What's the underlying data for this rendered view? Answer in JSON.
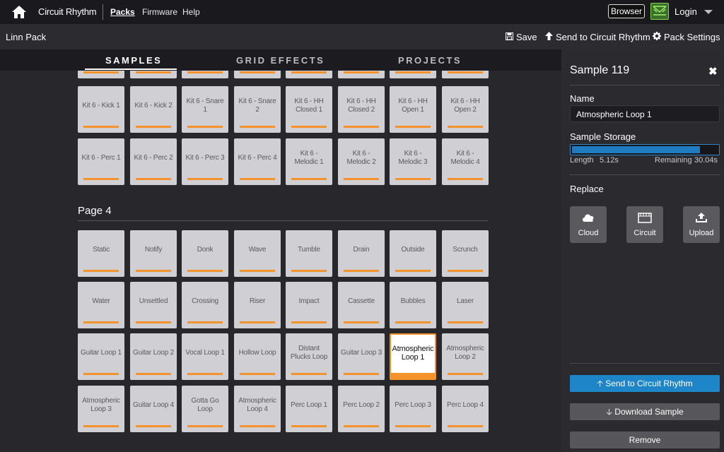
{
  "nav": {
    "brand": "Circuit Rhythm",
    "links": [
      "Packs",
      "Firmware",
      "Help"
    ],
    "browser_label": "Browser",
    "login_label": "Login"
  },
  "pack": {
    "name": "Linn Pack",
    "save_label": "Save",
    "send_label": "Send to Circuit Rhythm",
    "settings_label": "Pack Settings"
  },
  "tabs": [
    "SAMPLES",
    "GRID EFFECTS",
    "PROJECTS"
  ],
  "grid": {
    "page3_rows": [
      [
        "Kit 6 - Kick 1",
        "Kit 6 - Kick 2",
        "Kit 6 - Snare 1",
        "Kit 6 - Snare 2",
        "Kit 6 - HH Closed 1",
        "Kit 6 - HH Closed 2",
        "Kit 6 - HH Open 1",
        "Kit 6 - HH Open 2"
      ],
      [
        "Kit 6 - Perc 1",
        "Kit 6 - Perc 2",
        "Kit 6 - Perc 3",
        "Kit 6 - Perc 4",
        "Kit 6 - Melodic 1",
        "Kit 6 - Melodic 2",
        "Kit 6 - Melodic 3",
        "Kit 6 - Melodic 4"
      ]
    ],
    "page4_heading": "Page 4",
    "page4_rows": [
      [
        "Static",
        "Notify",
        "Donk",
        "Wave",
        "Tumble",
        "Drain",
        "Outside",
        "Scrunch"
      ],
      [
        "Water",
        "Unsettled",
        "Crossing",
        "Riser",
        "Impact",
        "Cassette",
        "Bubbles",
        "Laser"
      ],
      [
        "Guitar Loop 1",
        "Guitar Loop 2",
        "Vocal Loop 1",
        "Hollow Loop",
        "Distant Plucks Loop",
        "Guitar Loop 3",
        "Atmospheric Loop 1",
        "Atmospheric Loop 2"
      ],
      [
        "Atmospheric Loop 3",
        "Guitar Loop 4",
        "Gotta Go Loop",
        "Atmospheric Loop 4",
        "Perc Loop 1",
        "Perc Loop 2",
        "Perc Loop 3",
        "Perc Loop 4"
      ]
    ],
    "selected": "Atmospheric Loop 1",
    "accent_color": "#f4932c"
  },
  "panel": {
    "title": "Sample 119",
    "name_label": "Name",
    "name_value": "Atmospheric Loop 1",
    "storage_label": "Sample Storage",
    "storage_fill_fraction": 0.86,
    "length_label": "Length",
    "length_value": "5.12s",
    "remaining_label": "Remaining",
    "remaining_value": "30.04s",
    "replace_label": "Replace",
    "replace_buttons": [
      "Cloud",
      "Circuit",
      "Upload"
    ],
    "send_button": "Send to Circuit Rhythm",
    "download_button": "Download Sample",
    "remove_button": "Remove",
    "primary_color": "#1e86c8"
  }
}
